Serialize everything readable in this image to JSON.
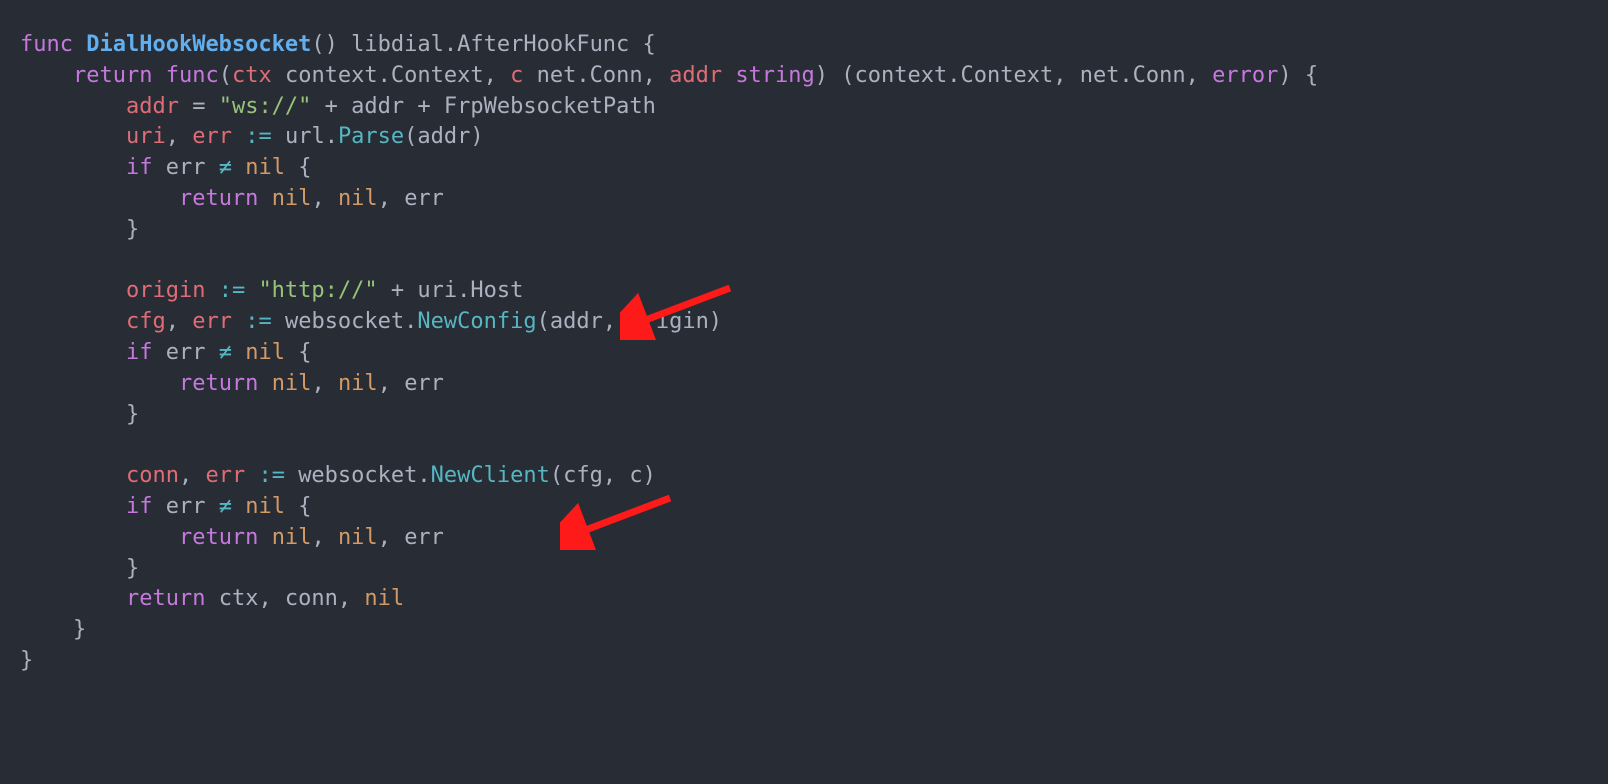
{
  "code": {
    "line1": {
      "kw_func": "func",
      "fn_name": "DialHookWebsocket",
      "parens": "()",
      "ret_type": " libdial.AfterHookFunc {"
    },
    "line2": {
      "indent": "    ",
      "kw_return": "return",
      "sp": " ",
      "kw_func": "func",
      "sig_open": "(",
      "p1": "ctx",
      "p1t": " context.Context, ",
      "p2": "c",
      "p2t": " net.Conn, ",
      "p3": "addr",
      "sp2": " ",
      "p3t": "string",
      "sig_mid": ") (context.Context, net.Conn, ",
      "err": "error",
      "sig_close": ") {"
    },
    "line3": {
      "indent": "        ",
      "lhs": "addr",
      "eq": " = ",
      "str1": "\"ws://\"",
      "plus1": " + ",
      "mid": "addr",
      "plus2": " + ",
      "tail": "FrpWebsocketPath"
    },
    "line4": {
      "indent": "        ",
      "v1": "uri",
      "c1": ", ",
      "v2": "err",
      "op": " := ",
      "pkg": "url.",
      "fn": "Parse",
      "args": "(addr)"
    },
    "line5": {
      "indent": "        ",
      "kw_if": "if",
      "sp": " ",
      "v": "err",
      "sp2": " ",
      "neq": "≠",
      "sp3": " ",
      "nil": "nil",
      "brace": " {"
    },
    "line6": {
      "indent": "            ",
      "kw_return": "return",
      "sp": " ",
      "n1": "nil",
      "c1": ", ",
      "n2": "nil",
      "c2": ", ",
      "v": "err"
    },
    "line7": {
      "indent": "        ",
      "brace": "}"
    },
    "line9": {
      "indent": "        ",
      "v": "origin",
      "op": " := ",
      "str": "\"http://\"",
      "plus": " + ",
      "tail": "uri.Host"
    },
    "line10": {
      "indent": "        ",
      "v1": "cfg",
      "c1": ", ",
      "v2": "err",
      "op": " := ",
      "pkg": "websocket.",
      "fn": "NewConfig",
      "args": "(addr, origin)"
    },
    "line11": {
      "indent": "        ",
      "kw_if": "if",
      "sp": " ",
      "v": "err",
      "sp2": " ",
      "neq": "≠",
      "sp3": " ",
      "nil": "nil",
      "brace": " {"
    },
    "line12": {
      "indent": "            ",
      "kw_return": "return",
      "sp": " ",
      "n1": "nil",
      "c1": ", ",
      "n2": "nil",
      "c2": ", ",
      "v": "err"
    },
    "line13": {
      "indent": "        ",
      "brace": "}"
    },
    "line15": {
      "indent": "        ",
      "v1": "conn",
      "c1": ", ",
      "v2": "err",
      "op": " := ",
      "pkg": "websocket.",
      "fn": "NewClient",
      "args": "(cfg, c)"
    },
    "line16": {
      "indent": "        ",
      "kw_if": "if",
      "sp": " ",
      "v": "err",
      "sp2": " ",
      "neq": "≠",
      "sp3": " ",
      "nil": "nil",
      "brace": " {"
    },
    "line17": {
      "indent": "            ",
      "kw_return": "return",
      "sp": " ",
      "n1": "nil",
      "c1": ", ",
      "n2": "nil",
      "c2": ", ",
      "v": "err"
    },
    "line18": {
      "indent": "        ",
      "brace": "}"
    },
    "line19": {
      "indent": "        ",
      "kw_return": "return",
      "sp": " ",
      "v1": "ctx, conn, ",
      "nil": "nil"
    },
    "line20": {
      "indent": "    ",
      "brace": "}"
    },
    "line21": {
      "brace": "}"
    }
  },
  "annotations": {
    "arrow1_target": "uri.Host line",
    "arrow2_target": "NewClient line"
  }
}
